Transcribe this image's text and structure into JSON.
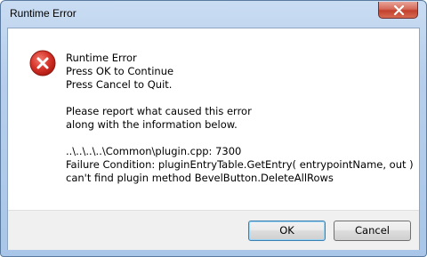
{
  "window": {
    "title": "Runtime Error"
  },
  "icons": {
    "error": "error-icon",
    "close": "close-icon"
  },
  "message": {
    "lines": [
      "Runtime Error",
      "Press OK to Continue",
      "Press Cancel to Quit.",
      "Please report what caused this error",
      "along with the information below.",
      "..\\..\\..\\..\\Common\\plugin.cpp: 7300",
      "Failure Condition: pluginEntryTable.GetEntry( entrypointName, out )",
      "can't find plugin method BevelButton.DeleteAllRows"
    ]
  },
  "buttons": {
    "ok": "OK",
    "cancel": "Cancel"
  },
  "colors": {
    "error_red": "#d32f2f",
    "close_red": "#c2412d",
    "default_button_border": "#3c7fb1"
  }
}
